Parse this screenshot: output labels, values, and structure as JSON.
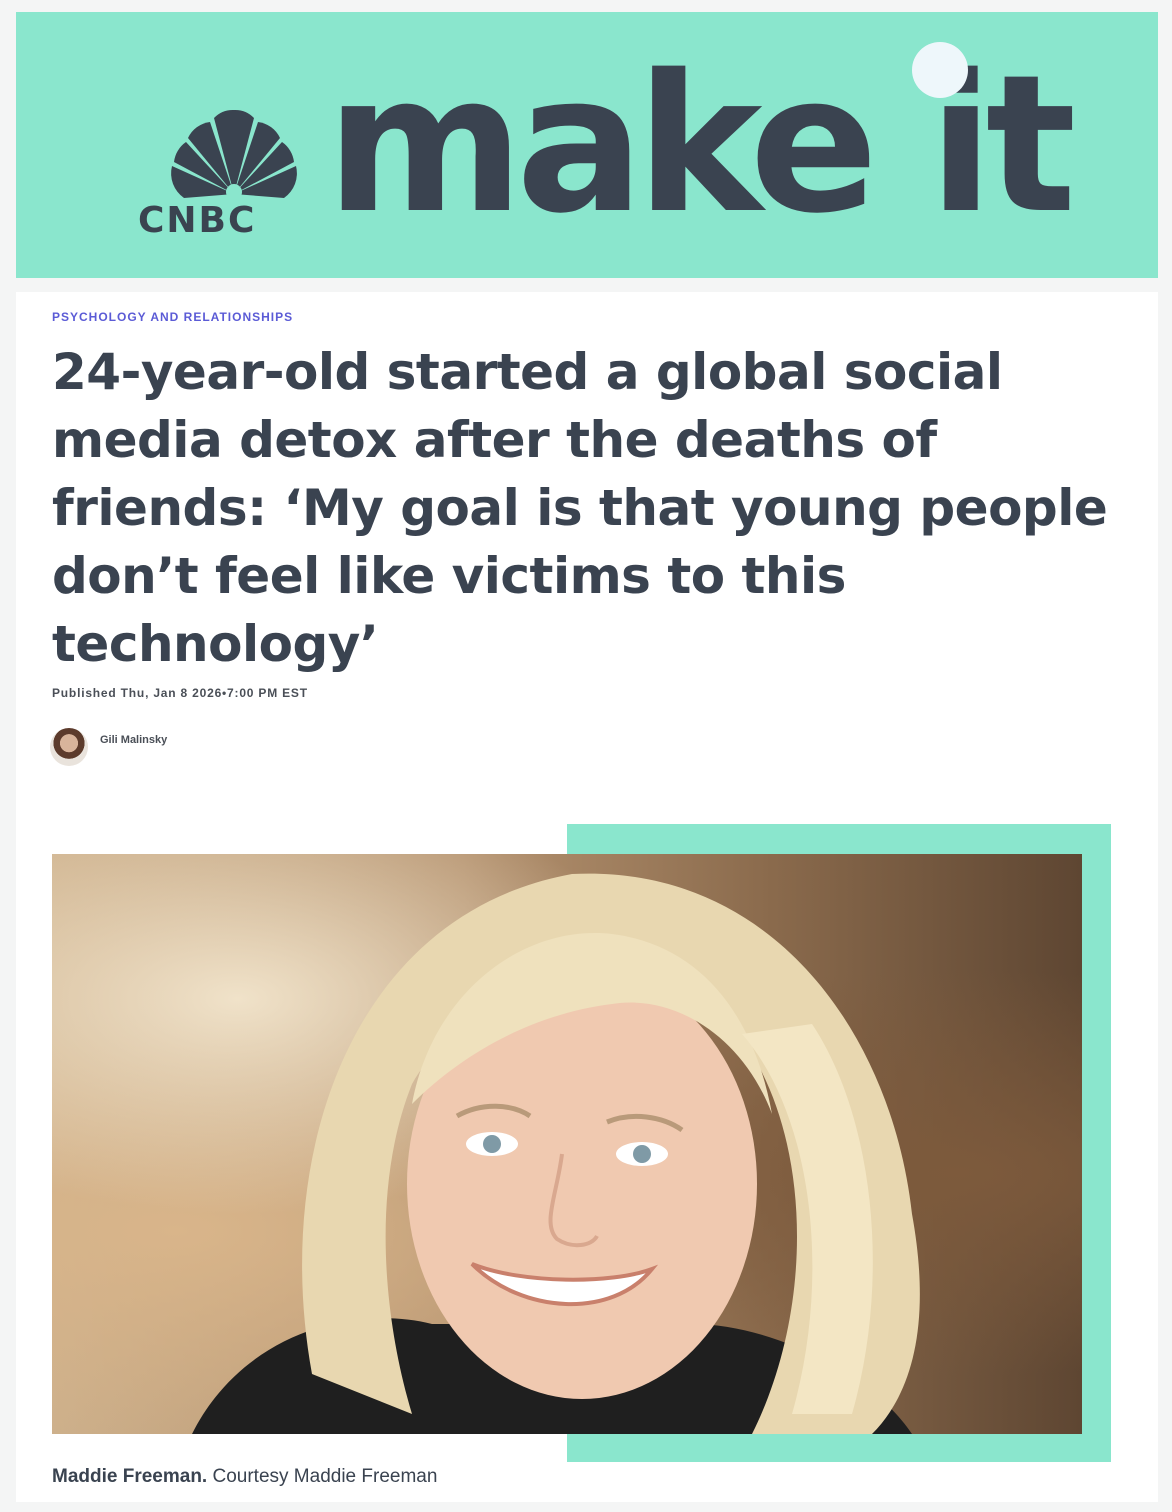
{
  "brand": {
    "network": "CNBC",
    "name": "make it",
    "logo_icon": "peacock-icon",
    "colors": {
      "mint": "#8ae6cd",
      "slate": "#3a4350",
      "kicker": "#5b5bd6"
    }
  },
  "article": {
    "category": "PSYCHOLOGY AND RELATIONSHIPS",
    "headline": "24-year-old started a global social media detox after the deaths of friends: ‘My goal is that young people don’t feel like victims to this technology’",
    "published": "Published Thu, Jan 8 2026•7:00 PM EST",
    "author": {
      "name": "Gili Malinsky"
    },
    "image": {
      "caption_name": "Maddie Freeman.",
      "caption_credit": "Courtesy Maddie Freeman"
    }
  }
}
